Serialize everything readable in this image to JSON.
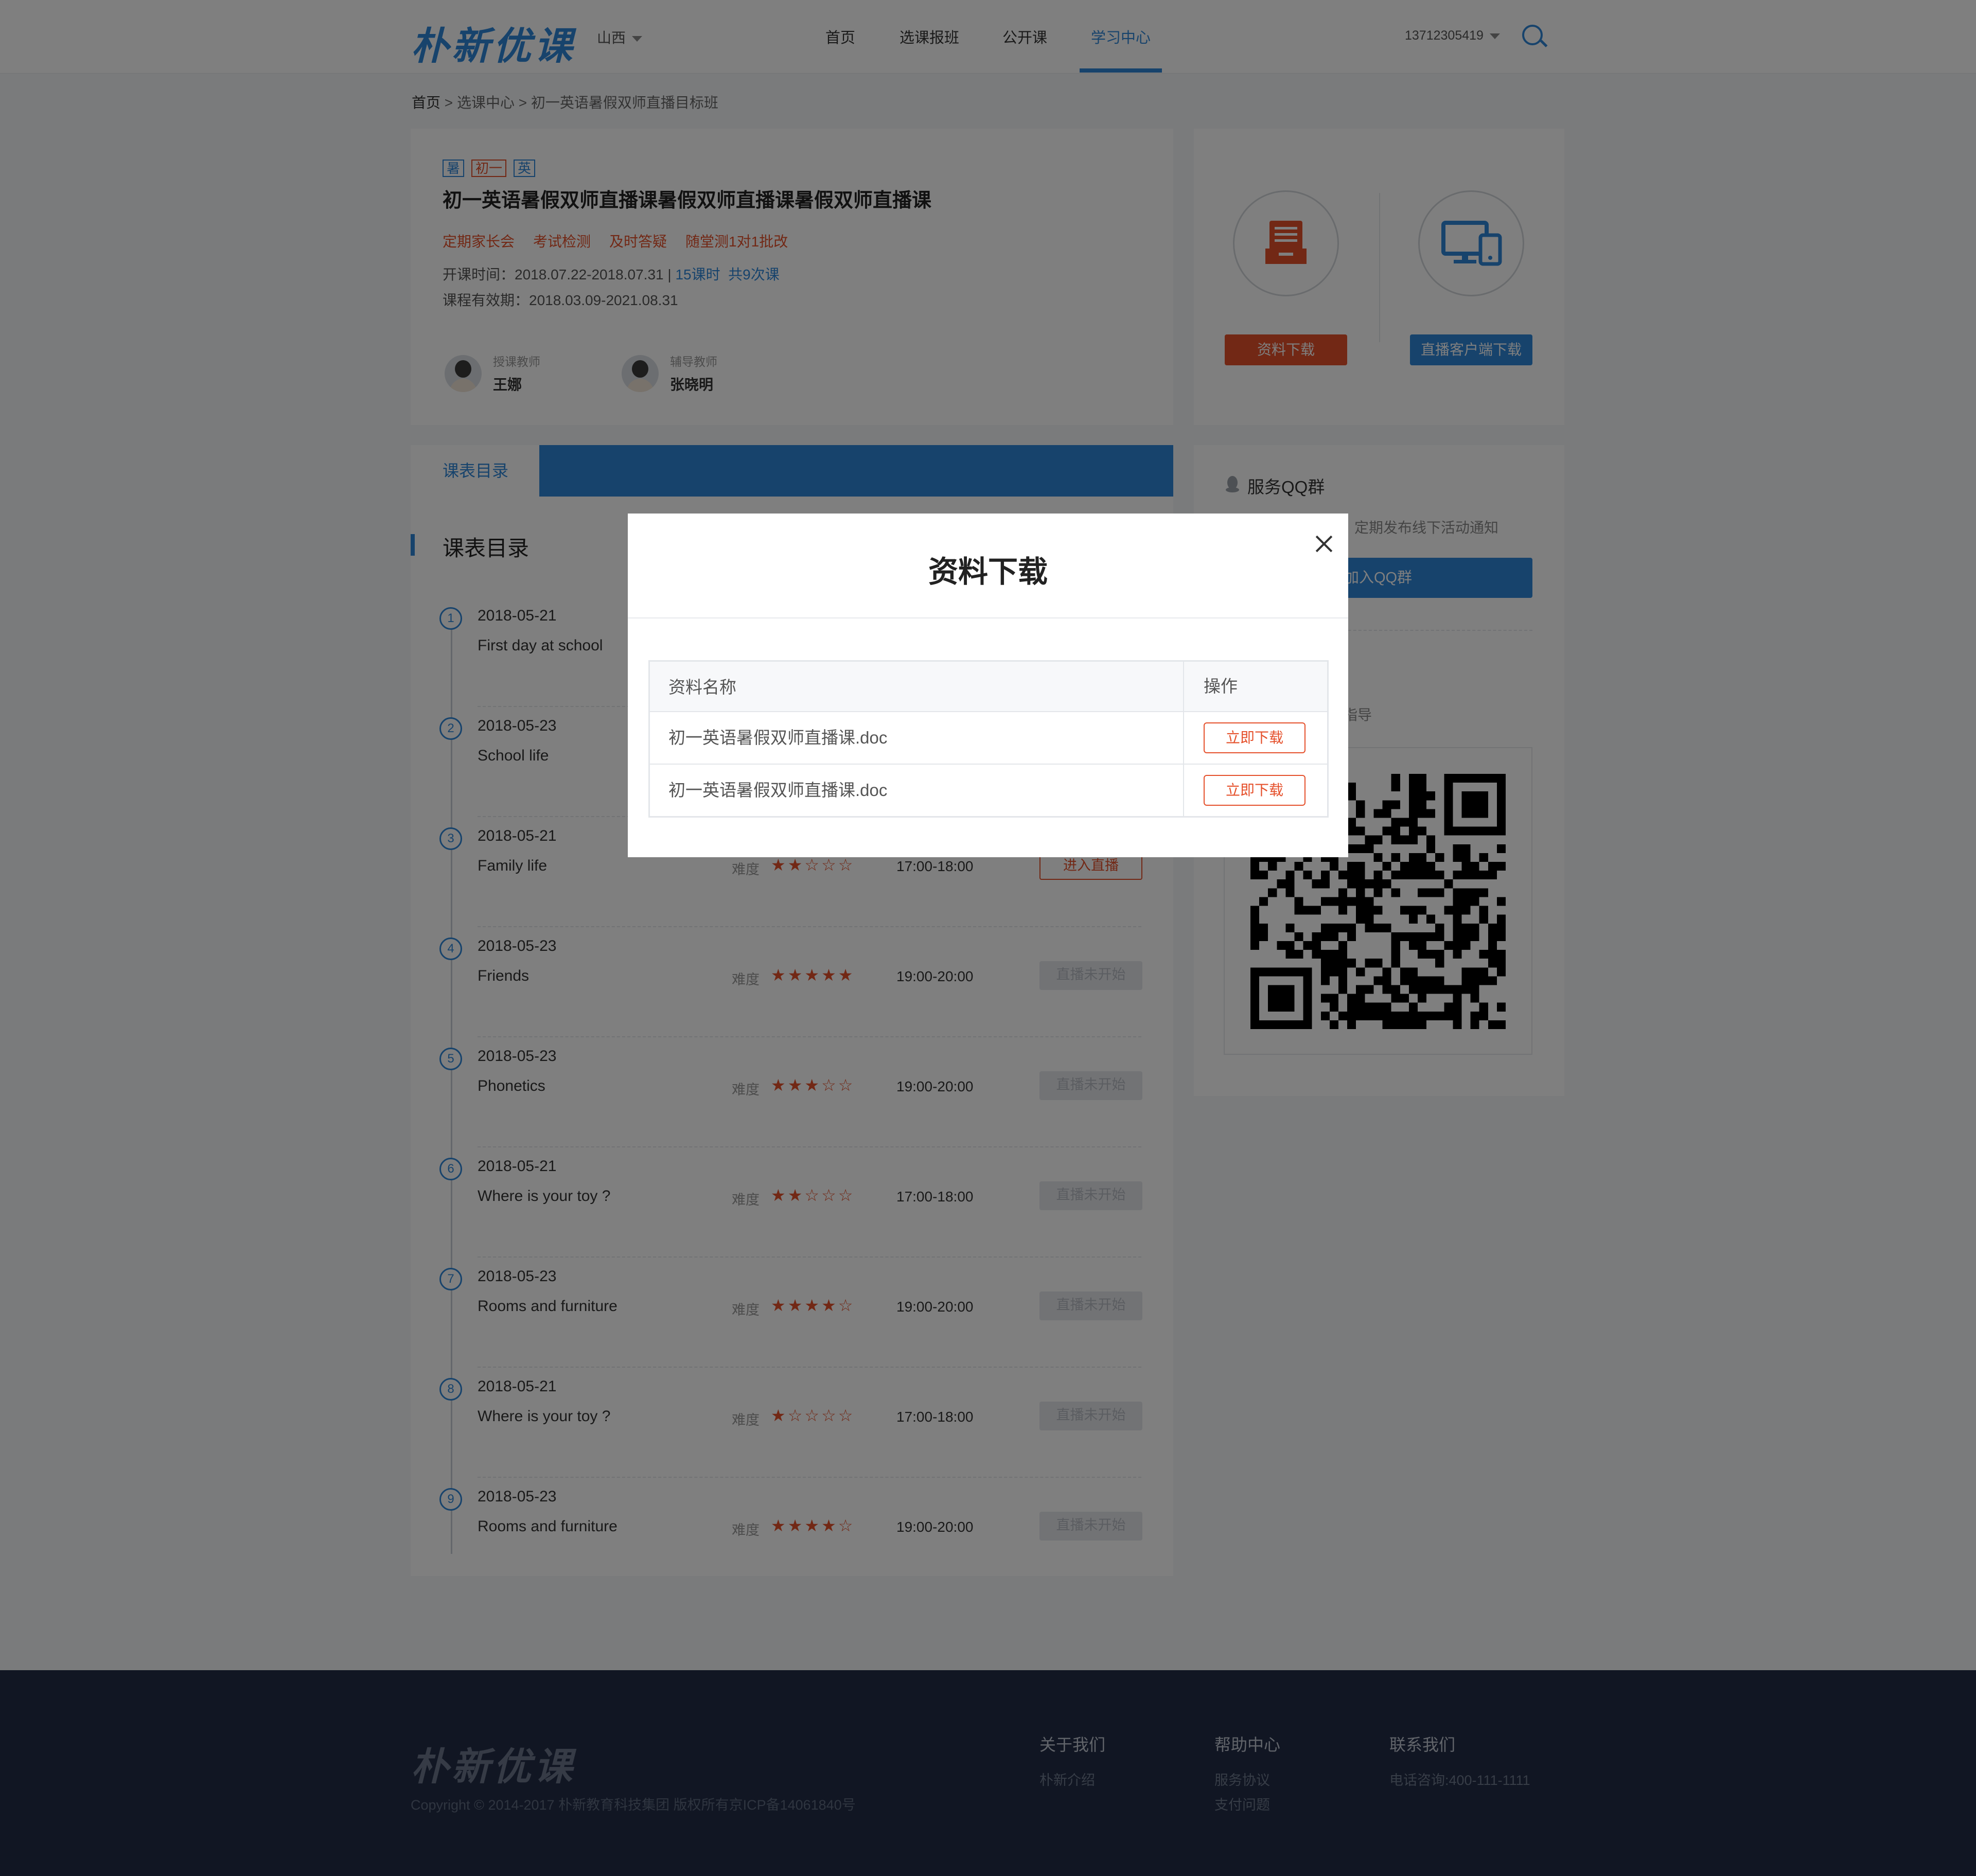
{
  "header": {
    "logo": "朴新优课",
    "region": "山西",
    "nav": [
      "首页",
      "选课报班",
      "公开课",
      "学习中心"
    ],
    "active_nav": "学习中心",
    "phone": "13712305419"
  },
  "breadcrumb": {
    "home": "首页",
    "sep1": ">",
    "center": "选课中心",
    "sep2": ">",
    "current": "初一英语暑假双师直播目标班"
  },
  "course": {
    "tags": [
      "暑",
      "初一",
      "英"
    ],
    "title": "初一英语暑假双师直播课暑假双师直播课暑假双师直播课",
    "features": [
      "定期家长会",
      "考试检测",
      "及时答疑",
      "随堂测1对1批改"
    ],
    "period_label": "开课时间：2018.07.22-2018.07.31 | ",
    "hours": "15课时",
    "count": "共9次课",
    "validity": "课程有效期：2018.03.09-2021.08.31",
    "teacher_role": "授课教师",
    "teacher_name": "王娜",
    "tutor_role": "辅导教师",
    "tutor_name": "张晓明"
  },
  "downloads": {
    "material_btn": "资料下载",
    "client_btn": "直播客户端下载"
  },
  "schedule": {
    "tab": "课表目录",
    "section_title": "课表目录",
    "diff_label": "难度",
    "lessons": [
      {
        "num": "1",
        "date": "2018-05-21",
        "title": "First day at school",
        "stars": "",
        "time": "",
        "btn": "",
        "btn_style": ""
      },
      {
        "num": "2",
        "date": "2018-05-23",
        "title": "School life",
        "stars": "",
        "time": "",
        "btn": "",
        "btn_style": ""
      },
      {
        "num": "3",
        "date": "2018-05-21",
        "title": "Family life",
        "stars": "★★☆☆☆",
        "time": "17:00-18:00",
        "btn": "进入直播",
        "btn_style": "live"
      },
      {
        "num": "4",
        "date": "2018-05-23",
        "title": "Friends",
        "stars": "★★★★★",
        "time": "19:00-20:00",
        "btn": "直播未开始",
        "btn_style": "off"
      },
      {
        "num": "5",
        "date": "2018-05-23",
        "title": "Phonetics",
        "stars": "★★★☆☆",
        "time": "19:00-20:00",
        "btn": "直播未开始",
        "btn_style": "off"
      },
      {
        "num": "6",
        "date": "2018-05-21",
        "title": "Where is your toy ?",
        "stars": "★★☆☆☆",
        "time": "17:00-18:00",
        "btn": "直播未开始",
        "btn_style": "off"
      },
      {
        "num": "7",
        "date": "2018-05-23",
        "title": "Rooms and furniture",
        "stars": "★★★★☆",
        "time": "19:00-20:00",
        "btn": "直播未开始",
        "btn_style": "off"
      },
      {
        "num": "8",
        "date": "2018-05-21",
        "title": "Where is your toy ?",
        "stars": "★☆☆☆☆",
        "time": "17:00-18:00",
        "btn": "直播未开始",
        "btn_style": "off"
      },
      {
        "num": "9",
        "date": "2018-05-23",
        "title": "Rooms and furniture",
        "stars": "★★★★☆",
        "time": "19:00-20:00",
        "btn": "直播未开始",
        "btn_style": "off"
      }
    ]
  },
  "service": {
    "title": "服务QQ群",
    "desc": "定期发布线下活动通知",
    "join_btn": "加入QQ群",
    "guide_text": "指导"
  },
  "modal": {
    "title": "资料下载",
    "col_name": "资料名称",
    "col_action": "操作",
    "files": [
      {
        "name": "初一英语暑假双师直播课.doc",
        "action": "立即下载"
      },
      {
        "name": "初一英语暑假双师直播课.doc",
        "action": "立即下载"
      }
    ]
  },
  "footer": {
    "logo": "朴新优课",
    "copyright": "Copyright © 2014-2017 朴新教育科技集团 版权所有京ICP备14061840号",
    "about": "关于我们",
    "about_link": "朴新介绍",
    "help": "帮助中心",
    "help_links": [
      "服务协议",
      "支付问题"
    ],
    "contact": "联系我们",
    "contact_phone": "电话咨询:400-111-1111"
  },
  "colors": {
    "brand_blue": "#2f86d8",
    "accent_orange": "#e5502b",
    "footer_bg": "#232d46"
  }
}
